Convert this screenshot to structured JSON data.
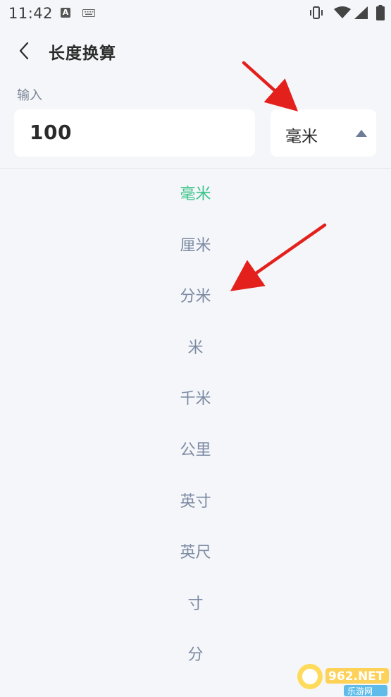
{
  "status_bar": {
    "time": "11:42",
    "notification_letter": "A"
  },
  "header": {
    "title": "长度换算"
  },
  "input": {
    "label": "输入",
    "value": "100"
  },
  "unit_selector": {
    "selected": "毫米",
    "expanded": true
  },
  "unit_options": [
    {
      "label": "毫米",
      "selected": true
    },
    {
      "label": "厘米",
      "selected": false
    },
    {
      "label": "分米",
      "selected": false
    },
    {
      "label": "米",
      "selected": false
    },
    {
      "label": "千米",
      "selected": false
    },
    {
      "label": "公里",
      "selected": false
    },
    {
      "label": "英寸",
      "selected": false
    },
    {
      "label": "英尺",
      "selected": false
    },
    {
      "label": "寸",
      "selected": false
    },
    {
      "label": "分",
      "selected": false
    }
  ],
  "colors": {
    "selected_option": "#3cc48b",
    "option_text": "#7c8aa3",
    "background": "#f4f6f9",
    "annotation_arrow": "#e3201b"
  },
  "watermark": {
    "brand": "962.NET",
    "sub": "乐游网"
  }
}
